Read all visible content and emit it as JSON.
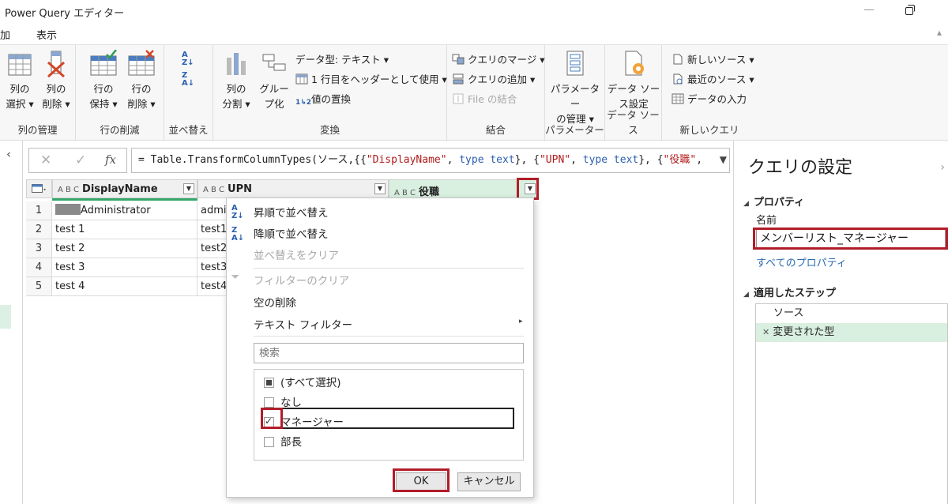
{
  "window": {
    "title": "Power Query エディター"
  },
  "menu": {
    "items": [
      "加",
      "表示"
    ]
  },
  "ribbon": {
    "groups": {
      "manage_columns": {
        "label": "列の管理",
        "choose_line1": "列の",
        "choose_line2": "選択 ▾",
        "remove_line1": "列の",
        "remove_line2": "削除 ▾"
      },
      "reduce_rows": {
        "label": "行の削減",
        "keep_line1": "行の",
        "keep_line2": "保持 ▾",
        "remove_line1": "行の",
        "remove_line2": "削除 ▾"
      },
      "sort": {
        "label": "並べ替え"
      },
      "transform": {
        "label": "変換",
        "split_line1": "列の",
        "split_line2": "分割 ▾",
        "group_line1": "グルー",
        "group_line2": "プ化",
        "data_type": "データ型: テキスト ▾",
        "use_first_row": "1 行目をヘッダーとして使用 ▾",
        "replace_values": "値の置換"
      },
      "combine": {
        "label": "結合",
        "merge": "クエリのマージ ▾",
        "append": "クエリの追加 ▾",
        "combine_files": "File の結合"
      },
      "parameters": {
        "label": "パラメーター",
        "manage_line1": "パラメーター",
        "manage_line2": "の管理 ▾"
      },
      "data_sources": {
        "label": "データ ソース",
        "settings_line1": "データ ソー",
        "settings_line2": "ス設定"
      },
      "new_query": {
        "label": "新しいクエリ",
        "new_source": "新しいソース ▾",
        "recent_sources": "最近のソース ▾",
        "enter_data": "データの入力"
      }
    }
  },
  "formula_bar": {
    "cancel_icon": "✕",
    "commit_icon": "✓",
    "fx_label": "fx",
    "parts": [
      "= Table.TransformColumnTypes(ソース,{{",
      "\"DisplayName\"",
      ", ",
      "type",
      " ",
      "text",
      "}, {",
      "\"UPN\"",
      ", ",
      "type",
      " ",
      "text",
      "}, {",
      "\"役職\"",
      ","
    ]
  },
  "grid": {
    "type_label": "A B C",
    "columns": [
      "DisplayName",
      "UPN",
      "役職"
    ],
    "rows": [
      {
        "n": "1",
        "display": "Administrator",
        "upn": "admi"
      },
      {
        "n": "2",
        "display": "test 1",
        "upn": "test1"
      },
      {
        "n": "3",
        "display": "test 2",
        "upn": "test2"
      },
      {
        "n": "4",
        "display": "test 3",
        "upn": "test3"
      },
      {
        "n": "5",
        "display": "test 4",
        "upn": "test4"
      }
    ]
  },
  "filter_menu": {
    "sort_asc": "昇順で並べ替え",
    "sort_desc": "降順で並べ替え",
    "clear_sort": "並べ替えをクリア",
    "clear_filter": "フィルターのクリア",
    "remove_empty": "空の削除",
    "text_filters": "テキスト フィルター",
    "search_placeholder": "検索",
    "values": [
      {
        "label": "(すべて選択)",
        "state": "partial"
      },
      {
        "label": "なし",
        "state": "unchecked"
      },
      {
        "label": "マネージャー",
        "state": "checked"
      },
      {
        "label": "部長",
        "state": "unchecked"
      }
    ],
    "ok": "OK",
    "cancel": "キャンセル"
  },
  "query_settings": {
    "title": "クエリの設定",
    "properties_header": "プロパティ",
    "name_label": "名前",
    "name_value": "メンバーリスト_マネージャー",
    "all_properties": "すべてのプロパティ",
    "steps_header": "適用したステップ",
    "steps": [
      "ソース",
      "変更された型"
    ],
    "step_icon": "✕"
  },
  "colors": {
    "highlight": "#b11d29",
    "active_step": "#d9efe0",
    "accent_blue": "#2b5fb0"
  }
}
